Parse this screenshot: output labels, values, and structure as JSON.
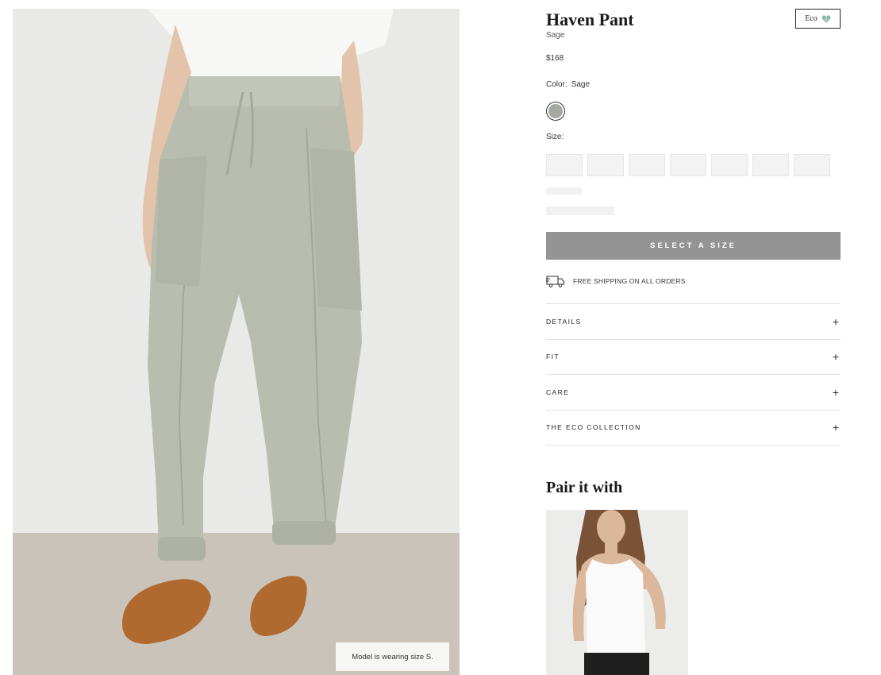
{
  "product": {
    "title": "Haven Pant",
    "color_subtitle": "Sage",
    "price": "$168",
    "badge_label": "Eco",
    "color_label": "Color:",
    "color_value": "Sage",
    "swatch_color": "#a6a9a0",
    "size_label": "Size:",
    "size_option_count": 7
  },
  "photo": {
    "model_note": "Model is wearing size S."
  },
  "cta": {
    "select_size_label": "SELECT A SIZE"
  },
  "shipping": {
    "text": "FREE SHIPPING ON ALL ORDERS",
    "icon": "truck-icon"
  },
  "accordion": {
    "items": [
      {
        "label": "DETAILS",
        "icon": "plus-icon"
      },
      {
        "label": "FIT",
        "icon": "plus-icon"
      },
      {
        "label": "CARE",
        "icon": "plus-icon"
      },
      {
        "label": "THE ECO COLLECTION",
        "icon": "plus-icon"
      }
    ]
  },
  "pair": {
    "title": "Pair it with"
  },
  "colors": {
    "button_bg": "#949494",
    "pant": "#b9bdaf",
    "sandal": "#b0692f",
    "wall": "#e9e9e7",
    "floor": "#c9c3ba"
  }
}
